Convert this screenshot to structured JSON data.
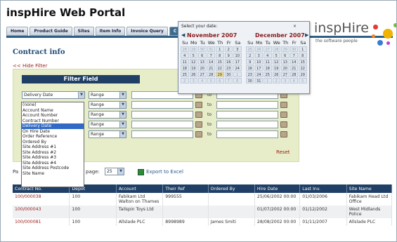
{
  "app": {
    "title": "inspHire Web Portal"
  },
  "brand": {
    "name": "inspHire",
    "tagline": "the software people"
  },
  "nav": {
    "tabs": [
      "Home",
      "Product Guide",
      "Sites",
      "Item Info",
      "Invoice Query",
      "C"
    ]
  },
  "page": {
    "title": "Contract info",
    "hide_filter": "<< Hide Filter"
  },
  "filter": {
    "header": "Filter Field",
    "rows": [
      {
        "field": "Delivery Date",
        "op": "Range"
      },
      {
        "field": "",
        "op": "Range"
      },
      {
        "field": "",
        "op": "Range"
      },
      {
        "field": "",
        "op": "Range"
      },
      {
        "field": "",
        "op": "Range"
      }
    ],
    "to_label": "to",
    "reset_label": "Reset",
    "dropdown_options": [
      "(none)",
      "Account Name",
      "Account Number",
      "Contract Number",
      "Delivery Date",
      "On Hire Date",
      "Order Reference",
      "Ordered By",
      "Site Address #1",
      "Site Address #2",
      "Site Address #3",
      "Site Address #4",
      "Site Address Postcode",
      "Site Name"
    ],
    "dropdown_selected": "Delivery Date"
  },
  "pagination": {
    "prefix": "Pa",
    "label": "page:",
    "per_page": "25",
    "export_label": "Export to Excel"
  },
  "table": {
    "columns": [
      "Contract No.",
      "Depot",
      "Account",
      "Their Ref",
      "Ordered By",
      "Hire Date",
      "Last Inv.",
      "Site Name"
    ],
    "rows": [
      [
        "100/000038",
        "100",
        "Fabikam Ltd Walton on Thames",
        "999555",
        "",
        "25/06/2002 00:00",
        "01/03/2006",
        "Fabikam Head Ltd Office"
      ],
      [
        "100/000043",
        "100",
        "Tailspin Toys Ltd",
        "",
        "",
        "01/07/2002 00:00",
        "01/12/2002",
        "West Midlands Police"
      ],
      [
        "100/000081",
        "100",
        "Allslade PLC",
        "8998989",
        "James Smiti",
        "28/08/2002 00:00",
        "01/11/2007",
        "Allslade PLC"
      ]
    ]
  },
  "calendar": {
    "title": "Select your date:",
    "close": "×",
    "months": [
      {
        "name": "November 2007",
        "dow": [
          "Su",
          "Mo",
          "Tu",
          "We",
          "Th",
          "Fr",
          "Sa"
        ],
        "weeks": [
          [
            "28",
            "29",
            "30",
            "31",
            "1",
            "2",
            "3"
          ],
          [
            "4",
            "5",
            "6",
            "7",
            "8",
            "9",
            "10"
          ],
          [
            "11",
            "12",
            "13",
            "14",
            "15",
            "16",
            "17"
          ],
          [
            "18",
            "19",
            "20",
            "21",
            "22",
            "23",
            "24"
          ],
          [
            "25",
            "26",
            "27",
            "28",
            "29",
            "30",
            "1"
          ],
          [
            "2",
            "3",
            "4",
            "5",
            "6",
            "7",
            "8"
          ]
        ]
      },
      {
        "name": "December 2007",
        "dow": [
          "Su",
          "Mo",
          "Tu",
          "We",
          "Th",
          "Fr",
          "Sa"
        ],
        "weeks": [
          [
            "25",
            "26",
            "27",
            "28",
            "29",
            "30",
            "1"
          ],
          [
            "2",
            "3",
            "4",
            "5",
            "6",
            "7",
            "8"
          ],
          [
            "9",
            "10",
            "11",
            "12",
            "13",
            "14",
            "15"
          ],
          [
            "16",
            "17",
            "18",
            "19",
            "20",
            "21",
            "22"
          ],
          [
            "23",
            "24",
            "25",
            "26",
            "27",
            "28",
            "29"
          ],
          [
            "30",
            "31",
            "1",
            "2",
            "3",
            "4",
            "5"
          ]
        ]
      }
    ],
    "today": "29"
  },
  "colors": {
    "nav_blue": "#1f3f66",
    "link_red": "#9b1c1c",
    "panel_green": "#e6edc8"
  }
}
